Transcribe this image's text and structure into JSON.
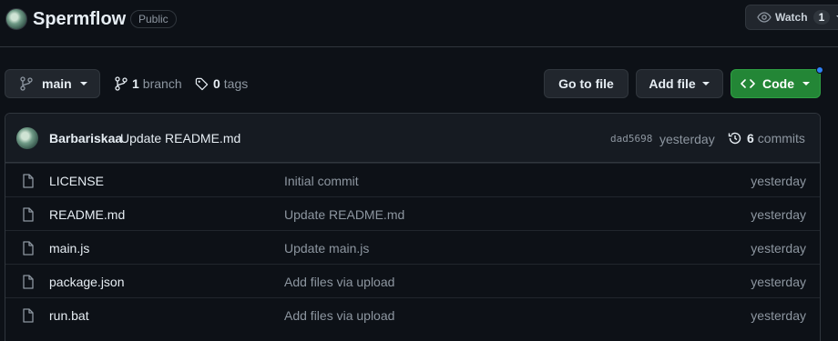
{
  "repo": {
    "name": "Spermflow",
    "visibility": "Public"
  },
  "watch": {
    "label": "Watch",
    "count": "1"
  },
  "toolbar": {
    "branch": "main",
    "branch_count": "1",
    "branch_label": "branch",
    "tag_count": "0",
    "tag_label": "tags",
    "goto_file": "Go to file",
    "add_file": "Add file",
    "code": "Code"
  },
  "latest_commit": {
    "author": "Barbariskaa",
    "message": "Update README.md",
    "hash": "dad5698",
    "time": "yesterday",
    "commit_count": "6",
    "commit_label": "commits"
  },
  "files": [
    {
      "name": "LICENSE",
      "message": "Initial commit",
      "time": "yesterday"
    },
    {
      "name": "README.md",
      "message": "Update README.md",
      "time": "yesterday"
    },
    {
      "name": "main.js",
      "message": "Update main.js",
      "time": "yesterday"
    },
    {
      "name": "package.json",
      "message": "Add files via upload",
      "time": "yesterday"
    },
    {
      "name": "run.bat",
      "message": "Add files via upload",
      "time": "yesterday"
    }
  ],
  "icons": {
    "watch": "eye-icon",
    "branch": "git-branch-icon",
    "tag": "tag-icon",
    "code": "code-icon",
    "history": "history-icon",
    "file": "file-icon"
  },
  "colors": {
    "background": "#0d1117",
    "border": "#30363d",
    "button": "#21262d",
    "code_button": "#238636",
    "muted_text": "#8d96a0",
    "text": "#e6edf3",
    "notification_dot": "#2f81f7"
  }
}
